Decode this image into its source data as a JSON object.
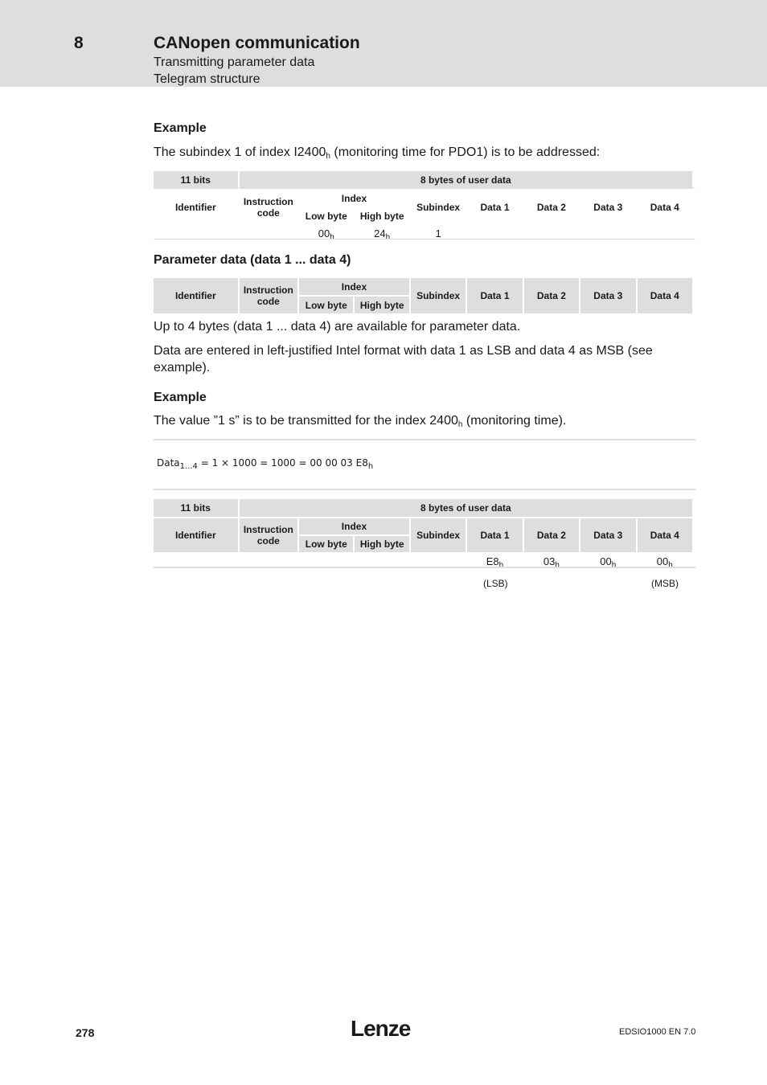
{
  "header": {
    "chapter_number": "8",
    "chapter_title": "CANopen communication",
    "subtitle1": "Transmitting parameter data",
    "subtitle2": "Telegram structure"
  },
  "section1": {
    "heading": "Example",
    "text_before": "The subindex 1 of index I2400",
    "text_sub": "h",
    "text_after": " (monitoring time for PDO1) is to be addressed:"
  },
  "table_headers": {
    "bits": "11 bits",
    "user_data": "8 bytes of user data",
    "identifier": "Identifier",
    "instruction": "Instruction",
    "code": "code",
    "index": "Index",
    "low_byte": "Low byte",
    "high_byte": "High byte",
    "subindex": "Subindex",
    "data1": "Data 1",
    "data2": "Data 2",
    "data3": "Data 3",
    "data4": "Data 4"
  },
  "table1_values": {
    "low_byte": "00",
    "low_byte_sub": "h",
    "high_byte": "24",
    "high_byte_sub": "h",
    "subindex": "1"
  },
  "section2": {
    "heading": "Parameter data (data 1 ... data 4)",
    "para1": "Up to 4 bytes (data 1 ... data 4) are available for parameter data.",
    "para2": "Data are entered in left-justified Intel format with data 1 as LSB and data 4 as MSB (see example)."
  },
  "section3": {
    "heading": "Example",
    "text_before": "The value ”1 s” is to be transmitted for the index 2400",
    "text_sub": "h",
    "text_after": " (monitoring time).",
    "formula_pre": "Data",
    "formula_sub": "1...4",
    "formula_post": " = 1 × 1000 = 1000 = 00 00 03 E8",
    "formula_h": "h"
  },
  "table3_values": {
    "data1": "E8",
    "data2": "03",
    "data3": "00",
    "data4": "00",
    "suffix": "h",
    "lsb": "(LSB)",
    "msb": "(MSB)"
  },
  "footer": {
    "page_number": "278",
    "logo": "Lenze",
    "doc_id": "EDSIO1000  EN  7.0"
  }
}
